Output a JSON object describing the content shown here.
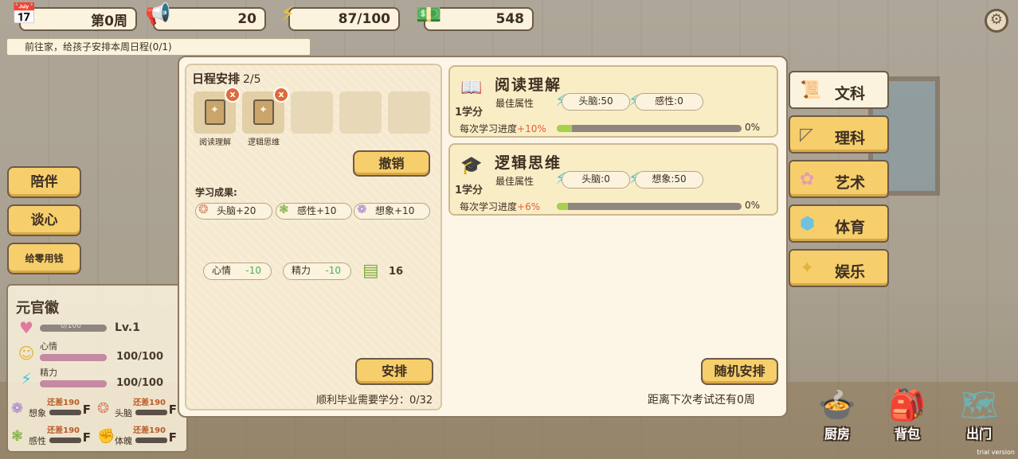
{
  "top_bar": {
    "week": "第0周",
    "reputation": "20",
    "energy": "87/100",
    "money": "548"
  },
  "task": "前往家，给孩子安排本周日程(0/1)",
  "left_buttons": [
    "陪伴",
    "谈心",
    "给零用钱"
  ],
  "character": {
    "name": "元官徽",
    "affection": {
      "text": "0/100",
      "level": "Lv.1",
      "fill": 0
    },
    "mood": {
      "label": "心情",
      "value": "100/100",
      "fill": 1
    },
    "energy": {
      "label": "精力",
      "value": "100/100",
      "fill": 1
    },
    "attributes": [
      {
        "icon": "imagination-icon",
        "name": "想象",
        "need": "还差190",
        "grade": "F"
      },
      {
        "icon": "brain-icon",
        "name": "头脑",
        "need": "还差190",
        "grade": "F"
      },
      {
        "icon": "sense-icon",
        "name": "感性",
        "need": "还差190",
        "grade": "F"
      },
      {
        "icon": "physique-icon",
        "name": "体魄",
        "need": "还差190",
        "grade": "F"
      }
    ]
  },
  "schedule": {
    "title": "日程安排",
    "count": "2/5",
    "slots": [
      {
        "label": "阅读理解",
        "filled": true
      },
      {
        "label": "逻辑思维",
        "filled": true
      },
      {
        "label": "",
        "filled": false
      },
      {
        "label": "",
        "filled": false
      },
      {
        "label": "",
        "filled": false
      }
    ],
    "undo_label": "撤销",
    "results_title": "学习成果:",
    "results": [
      {
        "icon": "brain-icon",
        "text": "头脑+20"
      },
      {
        "icon": "sense-icon",
        "text": "感性+10"
      },
      {
        "icon": "imagination-icon",
        "text": "想象+10"
      }
    ],
    "costs": [
      {
        "label": "心情",
        "value": "-10"
      },
      {
        "label": "精力",
        "value": "-10"
      }
    ],
    "money_cost": "16",
    "arrange_label": "安排",
    "credits_text": "顺利毕业需要学分：0/32"
  },
  "courses": [
    {
      "icon": "book-icon",
      "name": "阅读理解",
      "credit": "1学分",
      "best_label": "最佳属性",
      "attrs": [
        "头脑:50",
        "感性:0"
      ],
      "progress_label": "每次学习进度",
      "progress_plus": "+10%",
      "progress_pct": "0%",
      "progress": 0.08
    },
    {
      "icon": "cap-icon",
      "name": "逻辑思维",
      "credit": "1学分",
      "best_label": "最佳属性",
      "attrs": [
        "头脑:0",
        "想象:50"
      ],
      "progress_label": "每次学习进度",
      "progress_plus": "+6%",
      "progress_pct": "0%",
      "progress": 0.06
    }
  ],
  "random_label": "随机安排",
  "exam_text": "距离下次考试还有0周",
  "tabs": [
    {
      "label": "文科",
      "icon": "scroll-icon",
      "active": true
    },
    {
      "label": "理科",
      "icon": "ruler-icon",
      "active": false
    },
    {
      "label": "艺术",
      "icon": "flower-icon",
      "active": false
    },
    {
      "label": "体育",
      "icon": "cube-icon",
      "active": false
    },
    {
      "label": "娱乐",
      "icon": "star-icon",
      "active": false
    }
  ],
  "bottom_buttons": [
    {
      "label": "厨房",
      "icon": "pot-icon"
    },
    {
      "label": "背包",
      "icon": "backpack-icon"
    },
    {
      "label": "出门",
      "icon": "map-icon"
    }
  ],
  "trial_text": "trial version"
}
